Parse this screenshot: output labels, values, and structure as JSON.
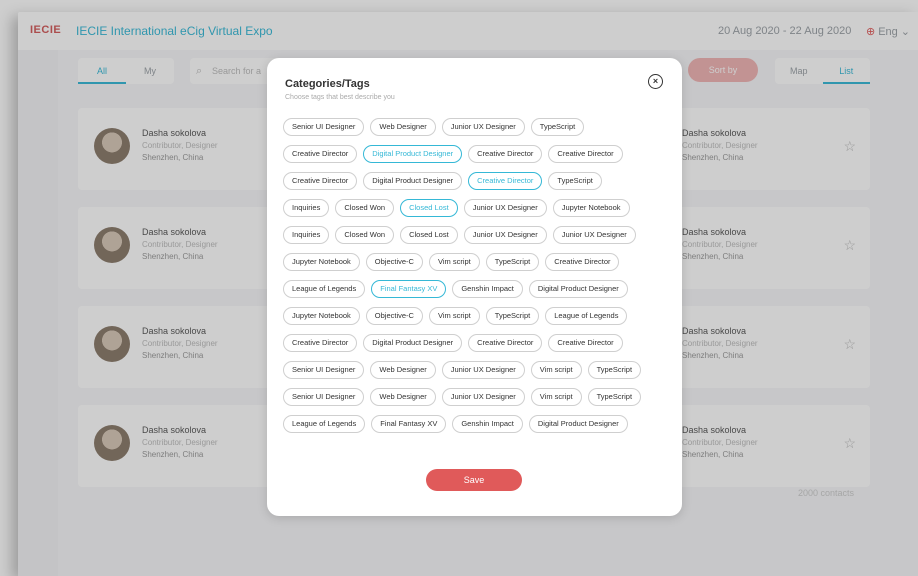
{
  "header": {
    "logo": "IECIE",
    "title": "IECIE International eCig Virtual Expo",
    "date_range": "20 Aug 2020 - 22 Aug 2020",
    "lang": "Eng",
    "accent_color": "#35b8d6",
    "brand_color": "#e05a5a"
  },
  "filters": {
    "tabs": [
      "All",
      "My"
    ],
    "active_tab": "All",
    "search_placeholder": "Search for a",
    "sort_label": "Sort by",
    "views": [
      "Map",
      "List"
    ],
    "active_view": "List"
  },
  "cards": [
    {
      "name": "Dasha sokolova",
      "role": "Contributor, Designer",
      "location": "Shenzhen, China"
    },
    {
      "name": "Dasha sokolova",
      "role": "Contributor, Designer",
      "location": "Shenzhen, China"
    },
    {
      "name": "Dasha sokolova",
      "role": "Contributor, Designer",
      "location": "Shenzhen, China"
    },
    {
      "name": "Dasha sokolova",
      "role": "Contributor, Designer",
      "location": "Shenzhen, China"
    },
    {
      "name": "Dasha sokolova",
      "role": "Contributor, Designer",
      "location": "Shenzhen, China"
    },
    {
      "name": "Dasha sokolova",
      "role": "Contributor, Designer",
      "location": "Shenzhen, China"
    },
    {
      "name": "Dasha sokolova",
      "role": "Contributor, Designer",
      "location": "Shenzhen, China"
    },
    {
      "name": "Dasha sokolova",
      "role": "Contributor, Designer",
      "location": "Shenzhen, China"
    }
  ],
  "contacts_count": "2000 contacts",
  "modal": {
    "title": "Categories/Tags",
    "subtitle": "Choose tags that best describe you",
    "close_label": "×",
    "save_label": "Save",
    "tag_rows": [
      [
        {
          "label": "Senior UI Designer",
          "selected": false
        },
        {
          "label": "Web Designer",
          "selected": false
        },
        {
          "label": "Junior UX Designer",
          "selected": false
        },
        {
          "label": "TypeScript",
          "selected": false
        }
      ],
      [
        {
          "label": "Creative Director",
          "selected": false
        },
        {
          "label": "Digital Product Designer",
          "selected": true
        },
        {
          "label": "Creative Director",
          "selected": false
        },
        {
          "label": "Creative Director",
          "selected": false
        }
      ],
      [
        {
          "label": "Creative Director",
          "selected": false
        },
        {
          "label": "Digital Product Designer",
          "selected": false
        },
        {
          "label": "Creative Director",
          "selected": true
        },
        {
          "label": "TypeScript",
          "selected": false
        }
      ],
      [
        {
          "label": "Inquiries",
          "selected": false
        },
        {
          "label": "Closed Won",
          "selected": false
        },
        {
          "label": "Closed Lost",
          "selected": true
        },
        {
          "label": "Junior UX Designer",
          "selected": false
        },
        {
          "label": "Jupyter Notebook",
          "selected": false
        }
      ],
      [
        {
          "label": "Inquiries",
          "selected": false
        },
        {
          "label": "Closed Won",
          "selected": false
        },
        {
          "label": "Closed Lost",
          "selected": false
        },
        {
          "label": "Junior UX Designer",
          "selected": false
        },
        {
          "label": "Junior UX Designer",
          "selected": false
        }
      ],
      [
        {
          "label": "Jupyter Notebook",
          "selected": false
        },
        {
          "label": "Objective-C",
          "selected": false
        },
        {
          "label": "Vim script",
          "selected": false
        },
        {
          "label": "TypeScript",
          "selected": false
        },
        {
          "label": "Creative Director",
          "selected": false
        }
      ],
      [
        {
          "label": "League of Legends",
          "selected": false
        },
        {
          "label": "Final Fantasy XV",
          "selected": true
        },
        {
          "label": "Genshin Impact",
          "selected": false
        },
        {
          "label": "Digital Product Designer",
          "selected": false
        }
      ],
      [
        {
          "label": "Jupyter Notebook",
          "selected": false
        },
        {
          "label": "Objective-C",
          "selected": false
        },
        {
          "label": "Vim script",
          "selected": false
        },
        {
          "label": "TypeScript",
          "selected": false
        },
        {
          "label": "League of Legends",
          "selected": false
        }
      ],
      [
        {
          "label": "Creative Director",
          "selected": false
        },
        {
          "label": "Digital Product Designer",
          "selected": false
        },
        {
          "label": "Creative Director",
          "selected": false
        },
        {
          "label": "Creative Director",
          "selected": false
        }
      ],
      [
        {
          "label": "Senior UI Designer",
          "selected": false
        },
        {
          "label": "Web Designer",
          "selected": false
        },
        {
          "label": "Junior UX Designer",
          "selected": false
        },
        {
          "label": "Vim script",
          "selected": false
        },
        {
          "label": "TypeScript",
          "selected": false
        }
      ],
      [
        {
          "label": "Senior UI Designer",
          "selected": false
        },
        {
          "label": "Web Designer",
          "selected": false
        },
        {
          "label": "Junior UX Designer",
          "selected": false
        },
        {
          "label": "Vim script",
          "selected": false
        },
        {
          "label": "TypeScript",
          "selected": false
        }
      ],
      [
        {
          "label": "League of Legends",
          "selected": false
        },
        {
          "label": "Final Fantasy XV",
          "selected": false
        },
        {
          "label": "Genshin Impact",
          "selected": false
        },
        {
          "label": "Digital Product Designer",
          "selected": false
        }
      ]
    ]
  }
}
